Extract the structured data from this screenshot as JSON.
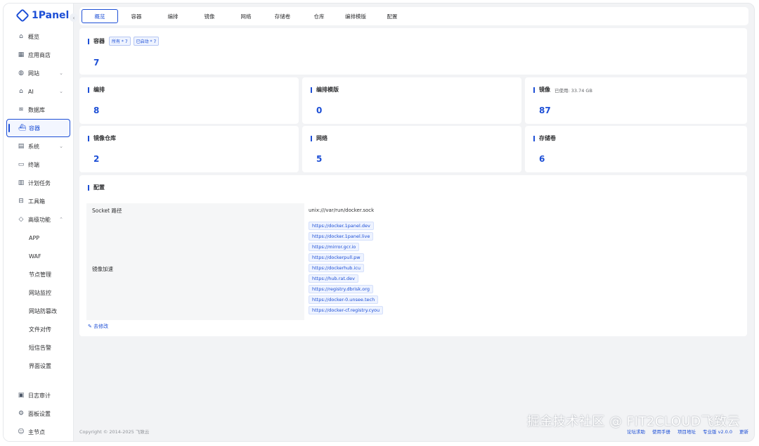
{
  "app": {
    "logo_text": "1Panel"
  },
  "sidebar": {
    "items": [
      {
        "label": "概览",
        "icon": "home-icon"
      },
      {
        "label": "应用商店",
        "icon": "grid-icon"
      },
      {
        "label": "网站",
        "icon": "globe-icon",
        "expand": true
      },
      {
        "label": "AI",
        "icon": "robot-icon",
        "expand": true
      },
      {
        "label": "数据库",
        "icon": "database-icon"
      },
      {
        "label": "容器",
        "icon": "container-icon",
        "active": true
      },
      {
        "label": "系统",
        "icon": "system-icon",
        "expand": true
      },
      {
        "label": "终端",
        "icon": "terminal-icon"
      },
      {
        "label": "计划任务",
        "icon": "calendar-icon"
      },
      {
        "label": "工具箱",
        "icon": "toolbox-icon"
      },
      {
        "label": "高级功能",
        "icon": "gem-icon",
        "expanded": true
      }
    ],
    "sub_items": [
      "APP",
      "WAF",
      "节点管理",
      "网站监控",
      "网站防篡改",
      "文件对传",
      "短信告警",
      "界面设置"
    ],
    "bottom_items": [
      {
        "label": "日志审计",
        "icon": "log-icon"
      },
      {
        "label": "面板设置",
        "icon": "settings-icon"
      },
      {
        "label": "主节点",
        "icon": "user-icon"
      }
    ]
  },
  "tabs": [
    "概览",
    "容器",
    "编排",
    "镜像",
    "网络",
    "存储卷",
    "仓库",
    "编排模版",
    "配置"
  ],
  "overview": {
    "containers": {
      "title": "容器",
      "tag_all": "所有 * 7",
      "tag_running": "已启动 * 7",
      "value": "7"
    },
    "compose": {
      "title": "编排",
      "value": "8"
    },
    "compose_template": {
      "title": "编排模版",
      "value": "0"
    },
    "images": {
      "title": "镜像",
      "used": "已使用: 33.74 GB",
      "value": "87"
    },
    "image_repo": {
      "title": "镜像仓库",
      "value": "2"
    },
    "network": {
      "title": "网络",
      "value": "5"
    },
    "volume": {
      "title": "存储卷",
      "value": "6"
    }
  },
  "config": {
    "title": "配置",
    "socket_label": "Socket 路径",
    "socket_value": "unix:///var/run/docker.sock",
    "mirror_label": "镜像加速",
    "mirrors": [
      "https://docker.1panel.dev",
      "https://docker.1panel.live",
      "https://mirror.gcr.io",
      "https://dockerpull.pw",
      "https://dockerhub.icu",
      "https://hub.rat.dev",
      "https://registry.dbrisk.org",
      "https://docker-0.unsee.tech",
      "https://docker-cf.registry.cyou"
    ],
    "edit_label": "去修改"
  },
  "footer": {
    "copyright": "Copyright © 2014-2025 飞致云",
    "links": [
      "论坛求助",
      "使用手册",
      "项目地址",
      "专业版 v2.0.0",
      "更新"
    ]
  },
  "watermark": "掘金技术社区 @ FIT2CLOUD飞致云",
  "colors": {
    "accent": "#1d4fd6",
    "background": "#f2f3f5"
  }
}
